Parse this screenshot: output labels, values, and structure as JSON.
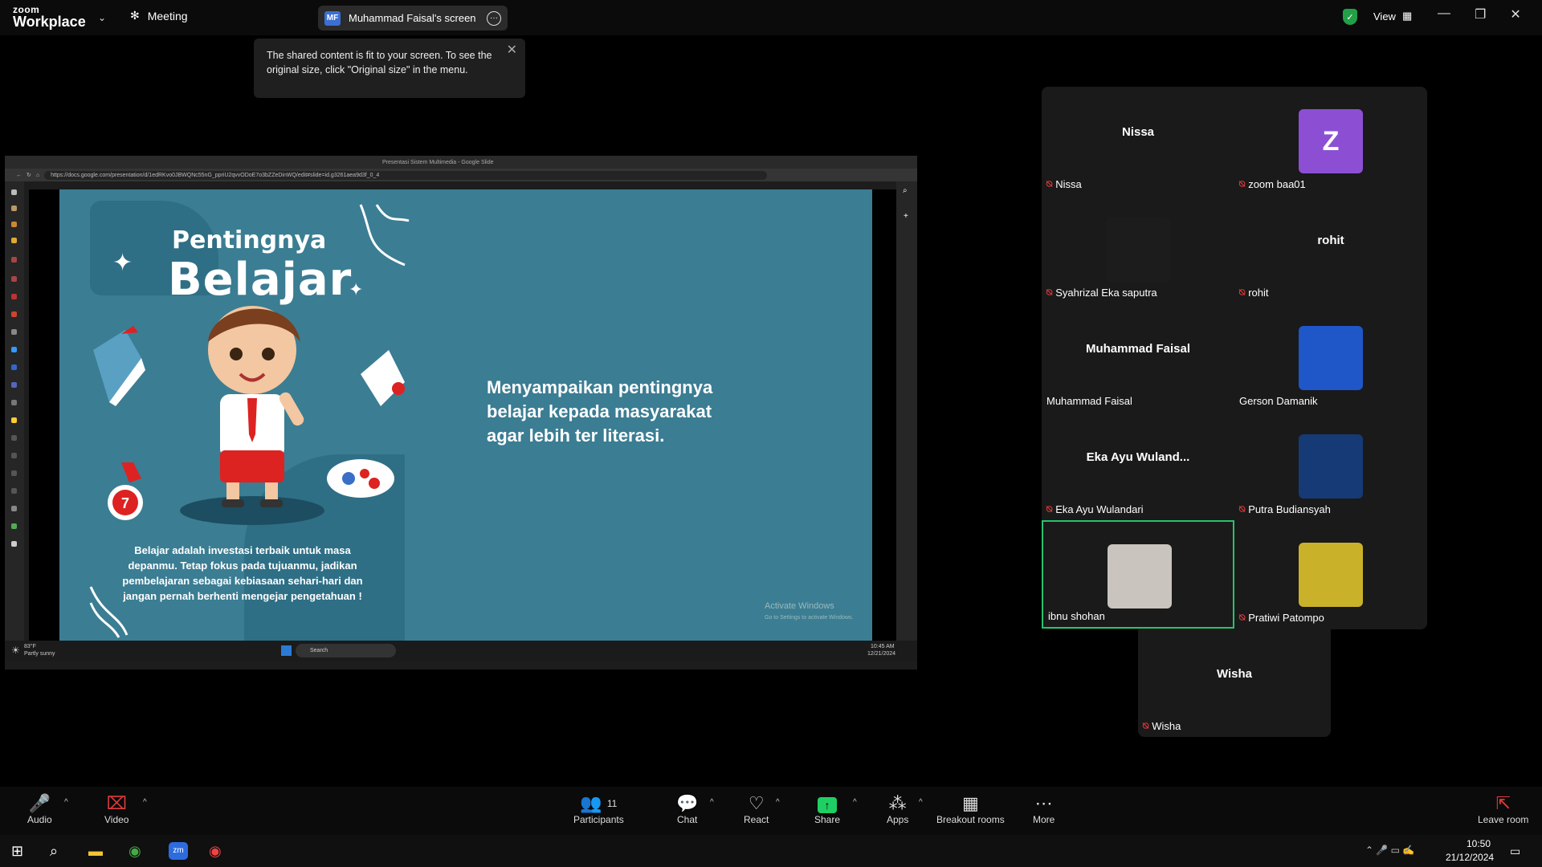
{
  "app": {
    "brand_top": "zoom",
    "brand_bottom": "Workplace",
    "meeting_label": "Meeting"
  },
  "screen_pill": {
    "initials": "MF",
    "title": "Muhammad Faisal's screen"
  },
  "tooltip": "The shared content is fit to your screen. To see the original size, click \"Original size\" in the menu.",
  "topright": {
    "view_label": "View"
  },
  "shared": {
    "tab_title": "Presentasi Sistem Multimedia - Google Slide",
    "url": "https://docs.google.com/presentation/d/1edRKvo0JBWQNc55nG_ppriU2qvvODoE7o3bZZeDinWQ/edit#slide=id.g3261aea9d3f_0_4",
    "slide": {
      "title_small": "Pentingnya",
      "title_big": "Belajar",
      "main_text": "Menyampaikan pentingnya belajar kepada masyarakat agar lebih ter literasi.",
      "quote": "Belajar adalah investasi terbaik untuk masa depanmu. Tetap fokus pada tujuanmu, jadikan pembelajaran sebagai kebiasaan sehari-hari dan jangan pernah berhenti mengejar pengetahuan !"
    },
    "activate_title": "Activate Windows",
    "activate_sub": "Go to Settings to activate Windows.",
    "weather_temp": "83°F",
    "weather_desc": "Partly sunny",
    "search_label": "Search",
    "inner_time": "10:45 AM",
    "inner_date": "12/21/2024"
  },
  "participants": [
    {
      "big": "Nissa",
      "label": "Nissa",
      "muted": true
    },
    {
      "big": "Z",
      "label": "zoom baa01",
      "muted": true,
      "avatar_color": "#8c4fd4"
    },
    {
      "big": "",
      "label": "Syahrizal Eka saputra",
      "muted": true,
      "avatar_color": "#1c1c1c"
    },
    {
      "big": "rohit",
      "label": "rohit",
      "muted": true
    },
    {
      "big": "Muhammad Faisal",
      "label": "Muhammad Faisal",
      "muted": false
    },
    {
      "big": "",
      "label": "Gerson Damanik",
      "muted": false,
      "avatar_color": "#1f56c8"
    },
    {
      "big": "Eka Ayu Wuland...",
      "label": "Eka Ayu Wulandari",
      "muted": true
    },
    {
      "big": "",
      "label": "Putra Budiansyah",
      "muted": true,
      "avatar_color": "#163a75"
    },
    {
      "big": "",
      "label": "ibnu shohan",
      "muted": false,
      "avatar_color": "#c9c4bd",
      "active": true
    },
    {
      "big": "",
      "label": "Pratiwi Patompo",
      "muted": true,
      "avatar_color": "#c9b22a"
    },
    {
      "big": "Wisha",
      "label": "Wisha",
      "muted": true
    }
  ],
  "toolbar": {
    "audio": "Audio",
    "video": "Video",
    "participants": "Participants",
    "participants_count": "11",
    "chat": "Chat",
    "react": "React",
    "share": "Share",
    "apps": "Apps",
    "breakout": "Breakout rooms",
    "more": "More",
    "leave": "Leave room"
  },
  "clock": {
    "time": "10:50",
    "date": "21/12/2024"
  },
  "colors": {
    "accent_green": "#27c36b",
    "mute_red": "#e03b3b",
    "share_green": "#1fcf63",
    "slide_bg": "#3b7d93"
  }
}
